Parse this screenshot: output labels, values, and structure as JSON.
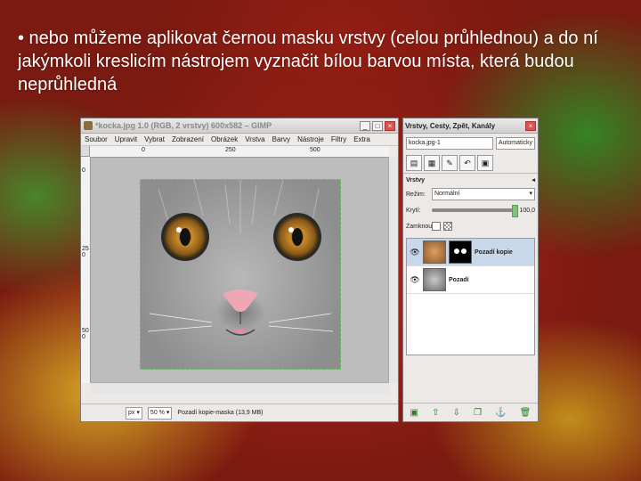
{
  "slide": {
    "bullet": "• nebo můžeme aplikovat černou masku vrstvy (celou průhlednou) a do ní jakýmkoli kreslicím nástrojem vyznačit bílou barvou místa, která budou neprůhledná"
  },
  "gimp": {
    "title": "*kocka.jpg 1.0 (RGB, 2 vrstvy) 600x582 – GIMP",
    "menu": [
      "Soubor",
      "Upravit",
      "Vybrat",
      "Zobrazení",
      "Obrázek",
      "Vrstva",
      "Barvy",
      "Nástroje",
      "Filtry",
      "Extra"
    ],
    "ruler_h": [
      "0",
      "250",
      "500"
    ],
    "ruler_v": [
      "0",
      "250",
      "500"
    ],
    "unit": "px",
    "zoom": "50 %",
    "status": "Pozadí kopie-maska (13,9 MB)"
  },
  "dock": {
    "title": "Vrstvy, Cesty, Zpět, Kanály",
    "image_select": "kocka.jpg-1",
    "auto_button": "Automaticky",
    "panel_label": "Vrstvy",
    "mode_label": "Režim:",
    "mode_value": "Normální",
    "opacity_label": "Krytí:",
    "opacity_value": "100,0",
    "opacity_fraction": 1.0,
    "lock_label": "Zamknout:",
    "layers": [
      {
        "name": "Pozadí kopie",
        "selected": true,
        "has_mask": true
      },
      {
        "name": "Pozadí",
        "selected": false,
        "has_mask": false
      }
    ]
  }
}
